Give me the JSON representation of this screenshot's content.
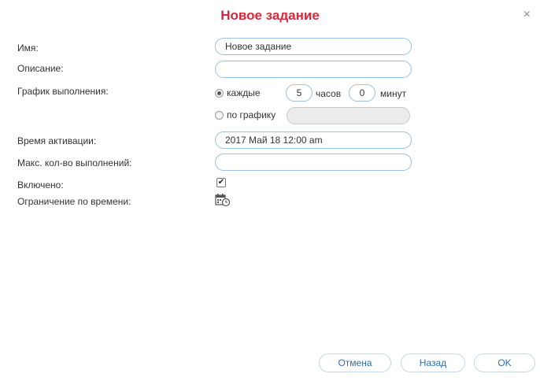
{
  "dialog": {
    "title": "Новое задание",
    "close": "×"
  },
  "labels": {
    "name": "Имя:",
    "description": "Описание:",
    "schedule": "График выполнения:",
    "activation_time": "Время активации:",
    "max_runs": "Макс. кол-во выполнений:",
    "enabled": "Включено:",
    "time_limit": "Ограничение по времени:"
  },
  "fields": {
    "name_value": "Новое задание",
    "description_value": "",
    "activation_time_value": "2017 Май 18 12:00 am",
    "max_runs_value": ""
  },
  "schedule": {
    "every_label": "каждые",
    "hours_value": "5",
    "hours_unit": "часов",
    "minutes_value": "0",
    "minutes_unit": "минут",
    "by_schedule_label": "по графику",
    "selected": "every"
  },
  "enabled": {
    "checked": true,
    "mark": "✔"
  },
  "icons": {
    "close": "close-icon",
    "time_limit": "calendar-clock-icon"
  },
  "buttons": {
    "cancel": "Отмена",
    "back": "Назад",
    "ok": "OK"
  },
  "colors": {
    "title": "#d9283b",
    "field_border": "#9cc0df",
    "button_text": "#2f6fae"
  }
}
